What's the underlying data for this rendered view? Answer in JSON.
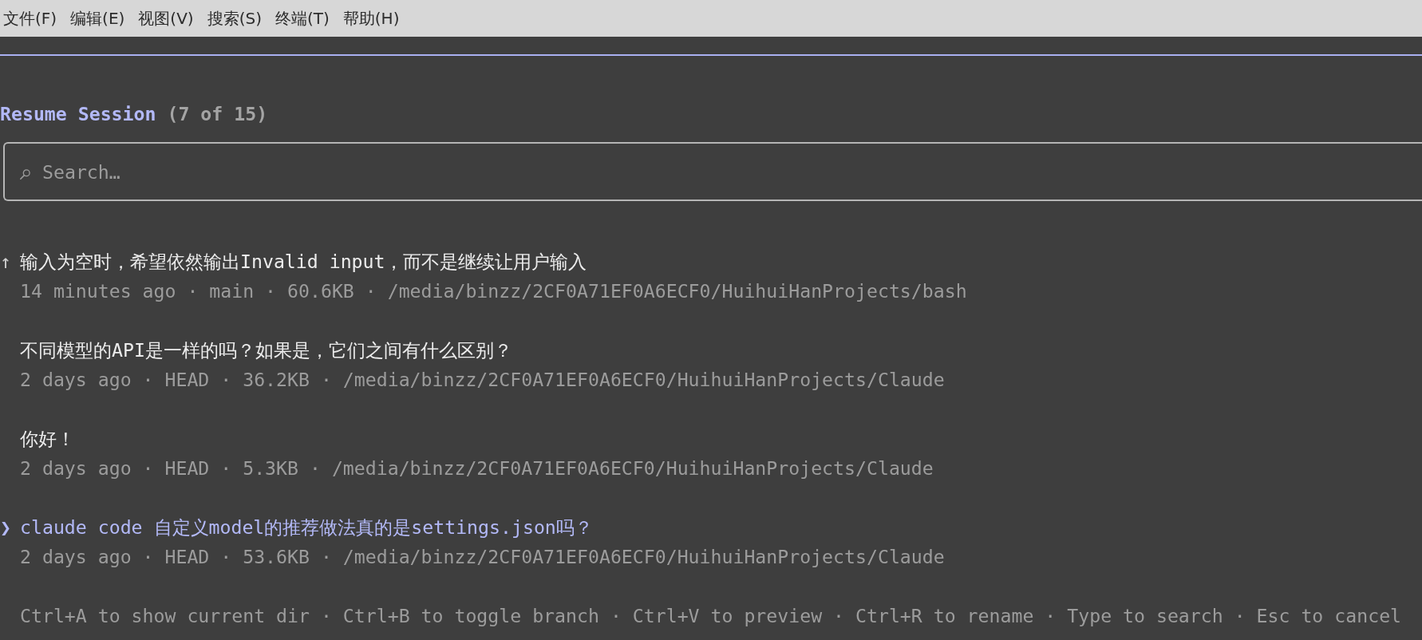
{
  "menu_bar": {
    "items": [
      "文件(F)",
      "编辑(E)",
      "视图(V)",
      "搜索(S)",
      "终端(T)",
      "帮助(H)"
    ]
  },
  "picker": {
    "title": "Resume Session",
    "count": "(7 of 15)",
    "search": {
      "placeholder": "Search…"
    },
    "cursor": "❯",
    "sessions": [
      {
        "prefix": "↑",
        "title": "输入为空时，希望依然输出Invalid input，而不是继续让用户输入",
        "meta": "14 minutes ago · main · 60.6KB · /media/binzz/2CF0A71EF0A6ECF0/HuihuiHanProjects/bash",
        "selected": false
      },
      {
        "title": "不同模型的API是一样的吗？如果是，它们之间有什么区别？",
        "meta": "2 days ago · HEAD · 36.2KB · /media/binzz/2CF0A71EF0A6ECF0/HuihuiHanProjects/Claude",
        "selected": false
      },
      {
        "title": "你好！",
        "meta": "2 days ago · HEAD · 5.3KB · /media/binzz/2CF0A71EF0A6ECF0/HuihuiHanProjects/Claude",
        "selected": false
      },
      {
        "title": "claude code 自定义model的推荐做法真的是settings.json吗？",
        "meta": "2 days ago · HEAD · 53.6KB · /media/binzz/2CF0A71EF0A6ECF0/HuihuiHanProjects/Claude",
        "selected": true
      }
    ],
    "footer": "Ctrl+A to show current dir · Ctrl+B to toggle branch · Ctrl+V to preview · Ctrl+R to rename · Type to search · Esc to cancel"
  }
}
